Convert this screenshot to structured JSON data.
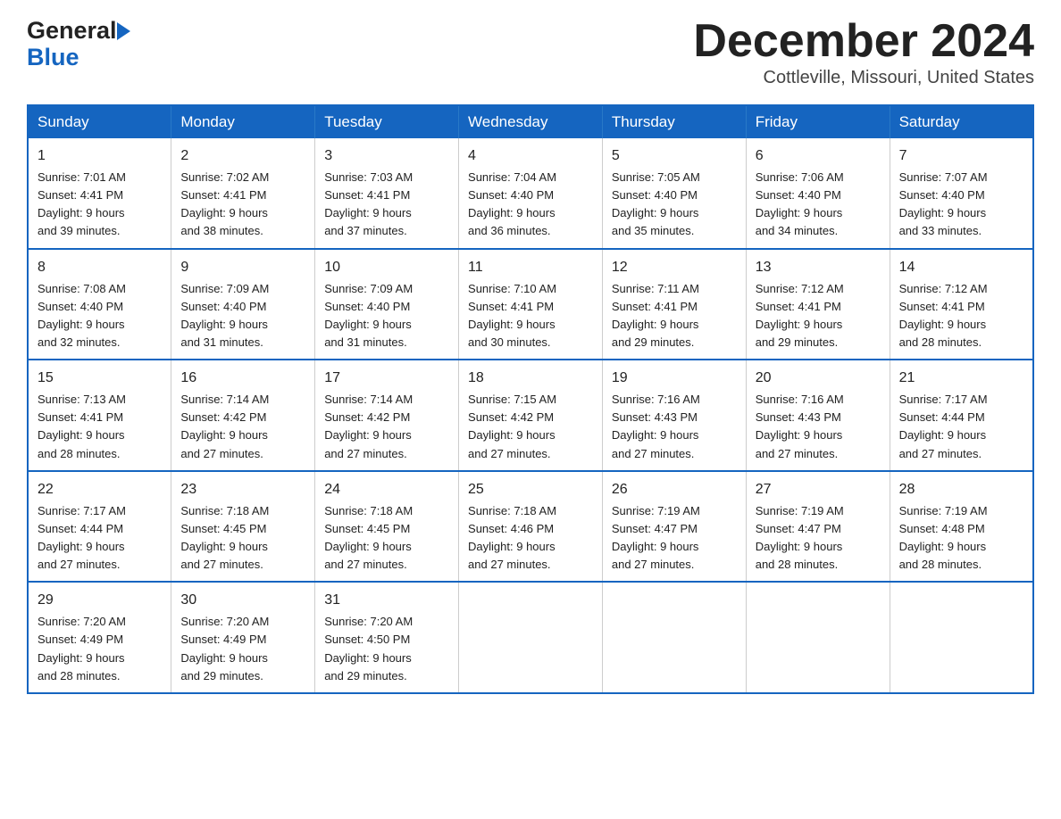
{
  "header": {
    "month_title": "December 2024",
    "location": "Cottleville, Missouri, United States",
    "logo_line1": "General",
    "logo_line2": "Blue"
  },
  "weekdays": [
    "Sunday",
    "Monday",
    "Tuesday",
    "Wednesday",
    "Thursday",
    "Friday",
    "Saturday"
  ],
  "weeks": [
    [
      {
        "day": "1",
        "sunrise": "7:01 AM",
        "sunset": "4:41 PM",
        "daylight": "9 hours and 39 minutes."
      },
      {
        "day": "2",
        "sunrise": "7:02 AM",
        "sunset": "4:41 PM",
        "daylight": "9 hours and 38 minutes."
      },
      {
        "day": "3",
        "sunrise": "7:03 AM",
        "sunset": "4:41 PM",
        "daylight": "9 hours and 37 minutes."
      },
      {
        "day": "4",
        "sunrise": "7:04 AM",
        "sunset": "4:40 PM",
        "daylight": "9 hours and 36 minutes."
      },
      {
        "day": "5",
        "sunrise": "7:05 AM",
        "sunset": "4:40 PM",
        "daylight": "9 hours and 35 minutes."
      },
      {
        "day": "6",
        "sunrise": "7:06 AM",
        "sunset": "4:40 PM",
        "daylight": "9 hours and 34 minutes."
      },
      {
        "day": "7",
        "sunrise": "7:07 AM",
        "sunset": "4:40 PM",
        "daylight": "9 hours and 33 minutes."
      }
    ],
    [
      {
        "day": "8",
        "sunrise": "7:08 AM",
        "sunset": "4:40 PM",
        "daylight": "9 hours and 32 minutes."
      },
      {
        "day": "9",
        "sunrise": "7:09 AM",
        "sunset": "4:40 PM",
        "daylight": "9 hours and 31 minutes."
      },
      {
        "day": "10",
        "sunrise": "7:09 AM",
        "sunset": "4:40 PM",
        "daylight": "9 hours and 31 minutes."
      },
      {
        "day": "11",
        "sunrise": "7:10 AM",
        "sunset": "4:41 PM",
        "daylight": "9 hours and 30 minutes."
      },
      {
        "day": "12",
        "sunrise": "7:11 AM",
        "sunset": "4:41 PM",
        "daylight": "9 hours and 29 minutes."
      },
      {
        "day": "13",
        "sunrise": "7:12 AM",
        "sunset": "4:41 PM",
        "daylight": "9 hours and 29 minutes."
      },
      {
        "day": "14",
        "sunrise": "7:12 AM",
        "sunset": "4:41 PM",
        "daylight": "9 hours and 28 minutes."
      }
    ],
    [
      {
        "day": "15",
        "sunrise": "7:13 AM",
        "sunset": "4:41 PM",
        "daylight": "9 hours and 28 minutes."
      },
      {
        "day": "16",
        "sunrise": "7:14 AM",
        "sunset": "4:42 PM",
        "daylight": "9 hours and 27 minutes."
      },
      {
        "day": "17",
        "sunrise": "7:14 AM",
        "sunset": "4:42 PM",
        "daylight": "9 hours and 27 minutes."
      },
      {
        "day": "18",
        "sunrise": "7:15 AM",
        "sunset": "4:42 PM",
        "daylight": "9 hours and 27 minutes."
      },
      {
        "day": "19",
        "sunrise": "7:16 AM",
        "sunset": "4:43 PM",
        "daylight": "9 hours and 27 minutes."
      },
      {
        "day": "20",
        "sunrise": "7:16 AM",
        "sunset": "4:43 PM",
        "daylight": "9 hours and 27 minutes."
      },
      {
        "day": "21",
        "sunrise": "7:17 AM",
        "sunset": "4:44 PM",
        "daylight": "9 hours and 27 minutes."
      }
    ],
    [
      {
        "day": "22",
        "sunrise": "7:17 AM",
        "sunset": "4:44 PM",
        "daylight": "9 hours and 27 minutes."
      },
      {
        "day": "23",
        "sunrise": "7:18 AM",
        "sunset": "4:45 PM",
        "daylight": "9 hours and 27 minutes."
      },
      {
        "day": "24",
        "sunrise": "7:18 AM",
        "sunset": "4:45 PM",
        "daylight": "9 hours and 27 minutes."
      },
      {
        "day": "25",
        "sunrise": "7:18 AM",
        "sunset": "4:46 PM",
        "daylight": "9 hours and 27 minutes."
      },
      {
        "day": "26",
        "sunrise": "7:19 AM",
        "sunset": "4:47 PM",
        "daylight": "9 hours and 27 minutes."
      },
      {
        "day": "27",
        "sunrise": "7:19 AM",
        "sunset": "4:47 PM",
        "daylight": "9 hours and 28 minutes."
      },
      {
        "day": "28",
        "sunrise": "7:19 AM",
        "sunset": "4:48 PM",
        "daylight": "9 hours and 28 minutes."
      }
    ],
    [
      {
        "day": "29",
        "sunrise": "7:20 AM",
        "sunset": "4:49 PM",
        "daylight": "9 hours and 28 minutes."
      },
      {
        "day": "30",
        "sunrise": "7:20 AM",
        "sunset": "4:49 PM",
        "daylight": "9 hours and 29 minutes."
      },
      {
        "day": "31",
        "sunrise": "7:20 AM",
        "sunset": "4:50 PM",
        "daylight": "9 hours and 29 minutes."
      },
      null,
      null,
      null,
      null
    ]
  ],
  "labels": {
    "sunrise_prefix": "Sunrise: ",
    "sunset_prefix": "Sunset: ",
    "daylight_prefix": "Daylight: "
  }
}
